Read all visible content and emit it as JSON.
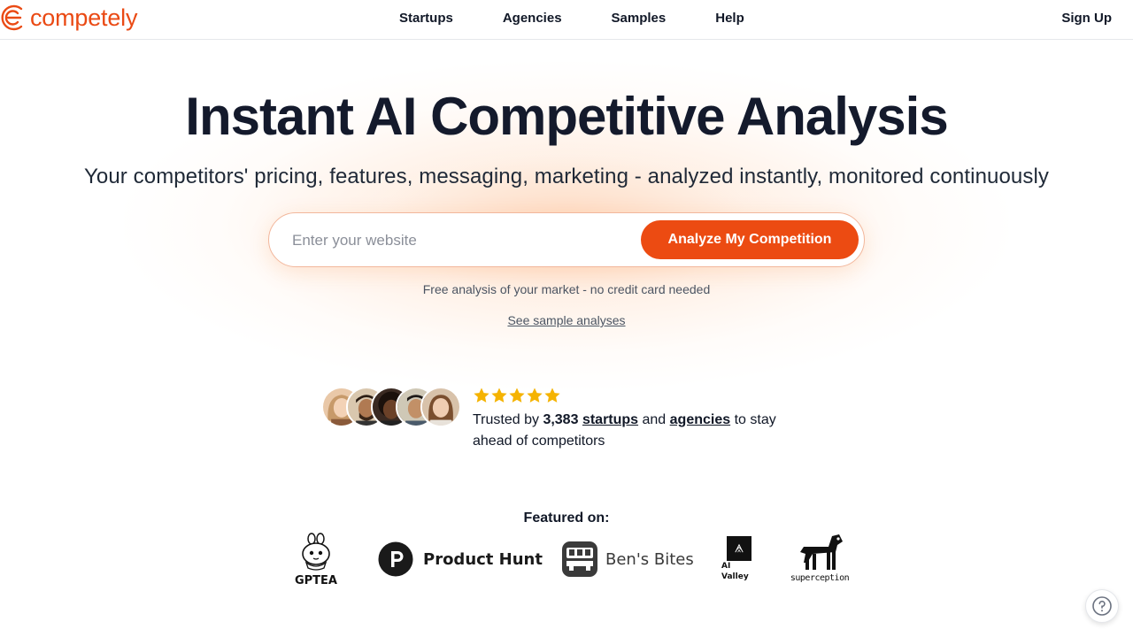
{
  "nav": {
    "brand": "competely",
    "links": [
      "Startups",
      "Agencies",
      "Samples",
      "Help"
    ],
    "signup": "Sign Up"
  },
  "hero": {
    "title": "Instant AI Competitive Analysis",
    "subtitle": "Your competitors' pricing, features, messaging, marketing - analyzed instantly, monitored continuously"
  },
  "search": {
    "placeholder": "Enter your website",
    "value": "",
    "button": "Analyze My Competition"
  },
  "free_note": "Free analysis of your market - no credit card needed",
  "sample_link": "See sample analyses",
  "trust": {
    "rating_stars": 5,
    "prefix": "Trusted by ",
    "count": "3,383",
    "startups": "startups",
    "and": " and ",
    "agencies": "agencies",
    "suffix": " to stay ahead of competitors"
  },
  "featured": {
    "title": "Featured on:",
    "logos": {
      "gptea": "GPTEA",
      "product_hunt": "Product Hunt",
      "bens_bites": "Ben's Bites",
      "ai_valley": "AI Valley",
      "superception": "superception"
    }
  },
  "colors": {
    "accent": "#ec4b12",
    "title": "#141a2c",
    "star": "#f5b301"
  }
}
